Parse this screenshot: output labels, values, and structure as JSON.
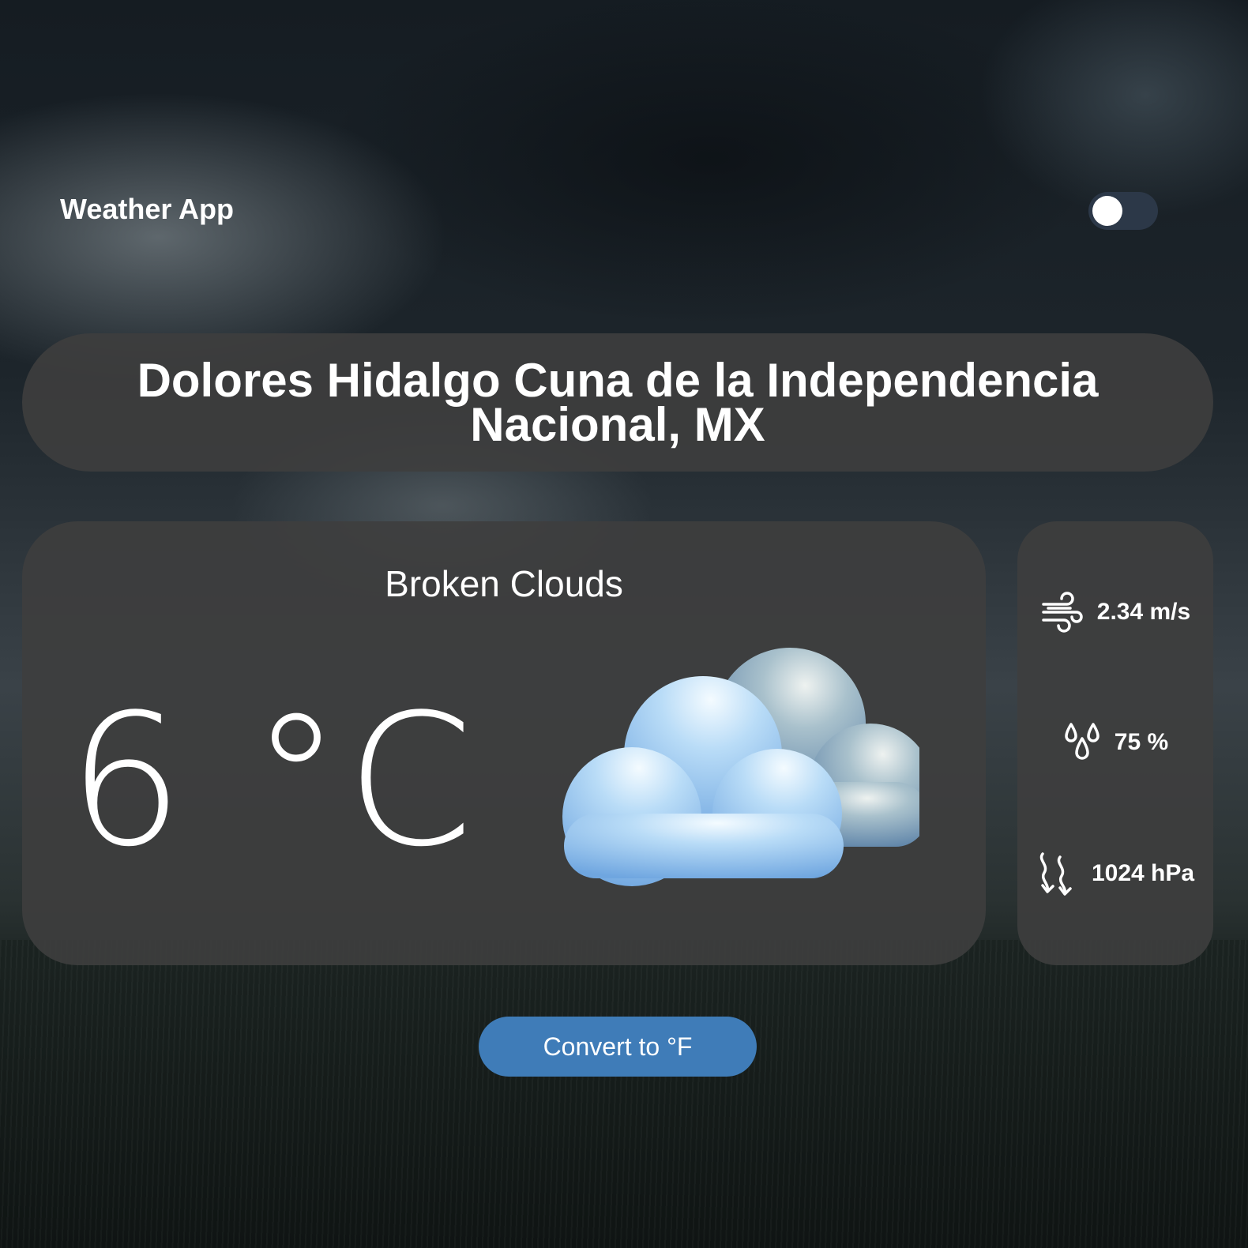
{
  "header": {
    "app_title": "Weather App",
    "theme_toggle": {
      "state": "off"
    }
  },
  "location": {
    "city": "Dolores Hidalgo Cuna de la Independencia Nacional, MX"
  },
  "current": {
    "condition": "Broken Clouds",
    "temperature": "6 °C",
    "icon": "broken-clouds-icon"
  },
  "stats": {
    "wind": {
      "icon": "wind-icon",
      "value": "2.34 m/s"
    },
    "humidity": {
      "icon": "humidity-icon",
      "value": "75 %"
    },
    "pressure": {
      "icon": "pressure-icon",
      "value": "1024 hPa"
    }
  },
  "actions": {
    "convert_label": "Convert to °F"
  },
  "colors": {
    "panel": "#3e3e3e",
    "accent": "#3f7cb8",
    "toggle_track": "#2c3848",
    "text": "#ffffff"
  }
}
